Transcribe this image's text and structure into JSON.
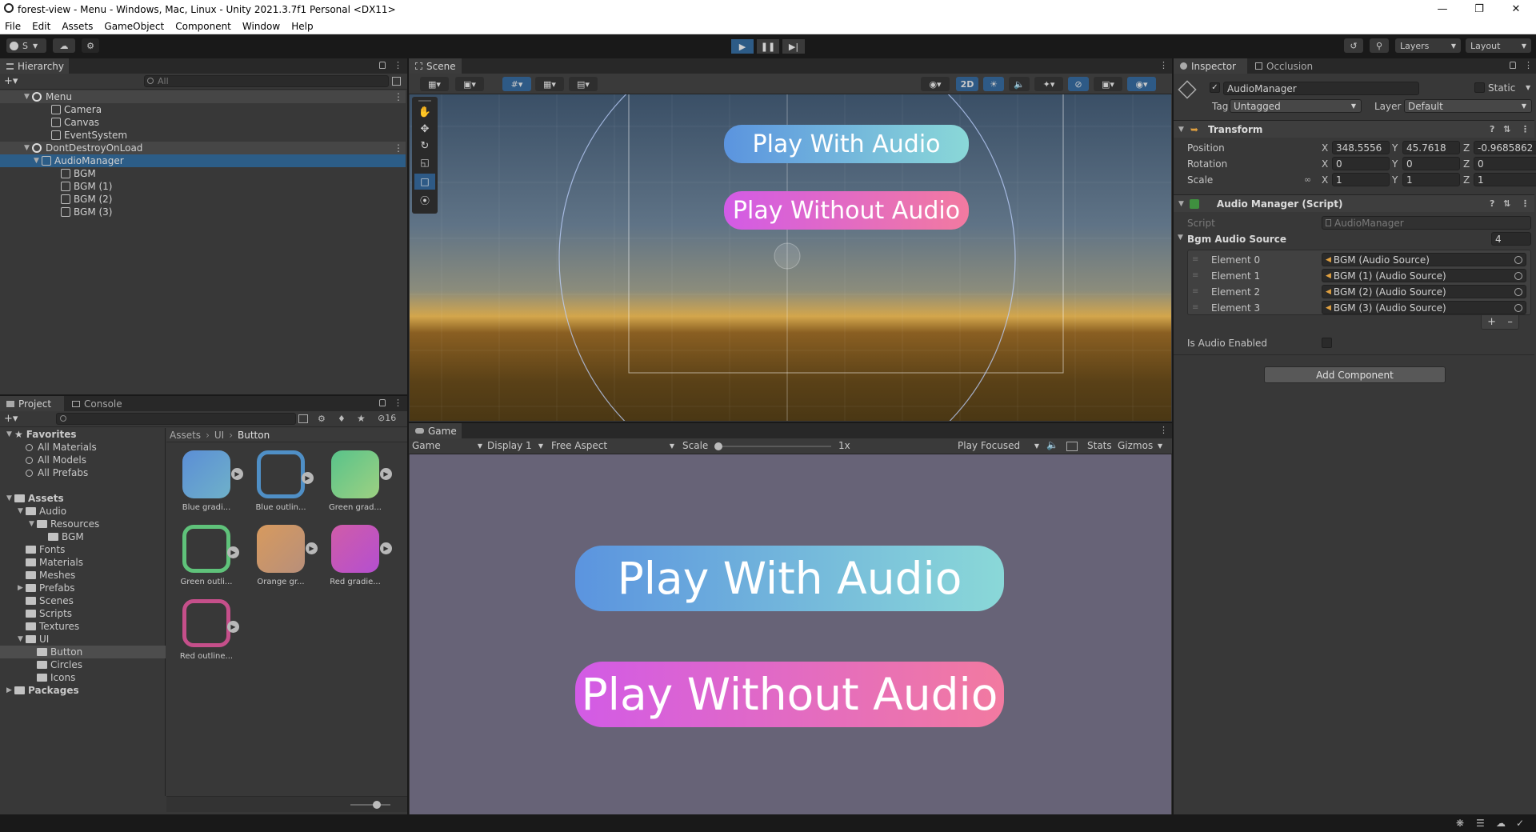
{
  "window": {
    "title": "forest-view - Menu - Windows, Mac, Linux - Unity 2021.3.7f1 Personal <DX11>"
  },
  "menu": [
    "File",
    "Edit",
    "Assets",
    "GameObject",
    "Component",
    "Window",
    "Help"
  ],
  "toolbar": {
    "account_label": "S",
    "layers_label": "Layers",
    "layout_label": "Layout"
  },
  "hierarchy": {
    "tab": "Hierarchy",
    "search_placeholder": "All",
    "rows": [
      {
        "label": "Menu",
        "depth": 0,
        "kind": "scene"
      },
      {
        "label": "Camera",
        "depth": 2,
        "kind": "object"
      },
      {
        "label": "Canvas",
        "depth": 2,
        "kind": "object"
      },
      {
        "label": "EventSystem",
        "depth": 2,
        "kind": "object"
      },
      {
        "label": "DontDestroyOnLoad",
        "depth": 0,
        "kind": "scene"
      },
      {
        "label": "AudioManager",
        "depth": 1,
        "kind": "selected"
      },
      {
        "label": "BGM",
        "depth": 3,
        "kind": "object"
      },
      {
        "label": "BGM (1)",
        "depth": 3,
        "kind": "object"
      },
      {
        "label": "BGM (2)",
        "depth": 3,
        "kind": "object"
      },
      {
        "label": "BGM (3)",
        "depth": 3,
        "kind": "object"
      }
    ]
  },
  "project": {
    "tabs": [
      "Project",
      "Console"
    ],
    "hidden_count": "16",
    "breadcrumb": [
      "Assets",
      "UI",
      "Button"
    ],
    "tree": [
      {
        "label": "Favorites",
        "depth": 0,
        "kind": "fav-root"
      },
      {
        "label": "All Materials",
        "depth": 1,
        "kind": "search"
      },
      {
        "label": "All Models",
        "depth": 1,
        "kind": "search"
      },
      {
        "label": "All Prefabs",
        "depth": 1,
        "kind": "search"
      },
      {
        "label": "Assets",
        "depth": 0,
        "kind": "root"
      },
      {
        "label": "Audio",
        "depth": 1,
        "kind": "folder"
      },
      {
        "label": "Resources",
        "depth": 2,
        "kind": "folder"
      },
      {
        "label": "BGM",
        "depth": 3,
        "kind": "folder"
      },
      {
        "label": "Fonts",
        "depth": 1,
        "kind": "folder"
      },
      {
        "label": "Materials",
        "depth": 1,
        "kind": "folder"
      },
      {
        "label": "Meshes",
        "depth": 1,
        "kind": "folder"
      },
      {
        "label": "Prefabs",
        "depth": 1,
        "kind": "folder"
      },
      {
        "label": "Scenes",
        "depth": 1,
        "kind": "folder"
      },
      {
        "label": "Scripts",
        "depth": 1,
        "kind": "folder"
      },
      {
        "label": "Textures",
        "depth": 1,
        "kind": "folder"
      },
      {
        "label": "UI",
        "depth": 1,
        "kind": "folder"
      },
      {
        "label": "Button",
        "depth": 2,
        "kind": "selected"
      },
      {
        "label": "Circles",
        "depth": 2,
        "kind": "folder"
      },
      {
        "label": "Icons",
        "depth": 2,
        "kind": "folder"
      },
      {
        "label": "Packages",
        "depth": 0,
        "kind": "root"
      }
    ],
    "assets": [
      {
        "label": "Blue gradi...",
        "style": "fill",
        "c1": "#5b8ed6",
        "c2": "#6fb1c9"
      },
      {
        "label": "Blue outlin...",
        "style": "outline",
        "c1": "#4f8fc6",
        "c2": "#4f8fc6"
      },
      {
        "label": "Green grad...",
        "style": "fill",
        "c1": "#58c38a",
        "c2": "#9ed182"
      },
      {
        "label": "Green outli...",
        "style": "outline",
        "c1": "#5fc27a",
        "c2": "#5fc27a"
      },
      {
        "label": "Orange gr...",
        "style": "fill",
        "c1": "#d79a5e",
        "c2": "#b88f7a"
      },
      {
        "label": "Red gradie...",
        "style": "fill",
        "c1": "#d05ca8",
        "c2": "#b44fd0"
      },
      {
        "label": "Red outline...",
        "style": "outline",
        "c1": "#c54f8a",
        "c2": "#c54f8a"
      }
    ]
  },
  "scene": {
    "tab": "Scene",
    "mode_2d": "2D",
    "buttons": [
      "Play With Audio",
      "Play Without Audio"
    ]
  },
  "game": {
    "tab": "Game",
    "view_select": "Game",
    "display_select": "Display 1",
    "aspect_select": "Free Aspect",
    "scale_label": "Scale",
    "scale_value": "1x",
    "play_focused": "Play Focused",
    "stats": "Stats",
    "gizmos": "Gizmos",
    "buttons": [
      "Play With Audio",
      "Play Without Audio"
    ]
  },
  "inspector": {
    "tabs": [
      "Inspector",
      "Occlusion"
    ],
    "object_name": "AudioManager",
    "static_label": "Static",
    "tag_label": "Tag",
    "tag_value": "Untagged",
    "layer_label": "Layer",
    "layer_value": "Default",
    "transform": {
      "title": "Transform",
      "position_label": "Position",
      "rotation_label": "Rotation",
      "scale_label": "Scale",
      "position": [
        "348.5556",
        "45.7618",
        "-0.9685862"
      ],
      "rotation": [
        "0",
        "0",
        "0"
      ],
      "scale": [
        "1",
        "1",
        "1"
      ]
    },
    "audio_manager": {
      "title": "Audio Manager (Script)",
      "script_label": "Script",
      "script_value": "AudioManager",
      "list_label": "Bgm Audio Source",
      "list_size": "4",
      "elements": [
        {
          "label": "Element 0",
          "value": "BGM (Audio Source)"
        },
        {
          "label": "Element 1",
          "value": "BGM (1) (Audio Source)"
        },
        {
          "label": "Element 2",
          "value": "BGM (2) (Audio Source)"
        },
        {
          "label": "Element 3",
          "value": "BGM (3) (Audio Source)"
        }
      ],
      "audio_enabled_label": "Is Audio Enabled",
      "audio_enabled": false
    },
    "add_component": "Add Component"
  },
  "colors": {
    "with_audio_start": "#5b94df",
    "with_audio_end": "#8ad8d8",
    "without_audio_start": "#d25be6",
    "without_audio_end": "#f27aa0",
    "selection": "#2c5d87"
  }
}
